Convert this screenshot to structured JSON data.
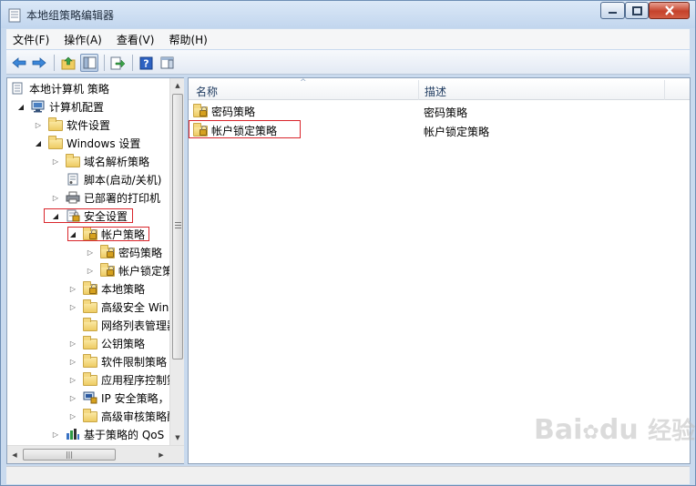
{
  "window": {
    "title": "本地组策略编辑器"
  },
  "menu": [
    "文件(F)",
    "操作(A)",
    "查看(V)",
    "帮助(H)"
  ],
  "toolbar": [
    {
      "icon": "back-arrow-icon"
    },
    {
      "icon": "forward-arrow-icon"
    },
    {
      "icon": "up-folder-icon"
    },
    {
      "icon": "show-hide-tree-icon",
      "active": true
    },
    {
      "icon": "export-list-icon"
    },
    {
      "icon": "help-icon"
    },
    {
      "icon": "properties-pane-icon"
    }
  ],
  "tree": [
    {
      "label": "本地计算机 策略",
      "level": 0,
      "expander": "none",
      "icon": "computer-policy-icon"
    },
    {
      "label": "计算机配置",
      "level": 1,
      "expander": "open",
      "icon": "computer-config-icon"
    },
    {
      "label": "软件设置",
      "level": 2,
      "expander": "closed",
      "icon": "folder-icon"
    },
    {
      "label": "Windows 设置",
      "level": 2,
      "expander": "open",
      "icon": "folder-icon"
    },
    {
      "label": "域名解析策略",
      "level": 3,
      "expander": "closed",
      "icon": "folder-icon"
    },
    {
      "label": "脚本(启动/关机)",
      "level": 3,
      "expander": "none",
      "icon": "script-icon"
    },
    {
      "label": "已部署的打印机",
      "level": 3,
      "expander": "closed",
      "icon": "printer-icon"
    },
    {
      "label": "安全设置",
      "level": 3,
      "expander": "open",
      "icon": "security-settings-icon",
      "highlight": true
    },
    {
      "label": "帐户策略",
      "level": 4,
      "expander": "open",
      "icon": "locked-folder-icon",
      "highlight": true
    },
    {
      "label": "密码策略",
      "level": 5,
      "expander": "closed",
      "icon": "locked-folder-icon"
    },
    {
      "label": "帐户锁定策略",
      "level": 5,
      "expander": "closed",
      "icon": "locked-folder-icon"
    },
    {
      "label": "本地策略",
      "level": 4,
      "expander": "closed",
      "icon": "locked-folder-icon"
    },
    {
      "label": "高级安全 Windows 防火墙",
      "level": 4,
      "expander": "closed",
      "icon": "folder-icon"
    },
    {
      "label": "网络列表管理器策略",
      "level": 4,
      "expander": "none",
      "icon": "folder-icon"
    },
    {
      "label": "公钥策略",
      "level": 4,
      "expander": "closed",
      "icon": "folder-icon"
    },
    {
      "label": "软件限制策略",
      "level": 4,
      "expander": "closed",
      "icon": "folder-icon"
    },
    {
      "label": "应用程序控制策略",
      "level": 4,
      "expander": "closed",
      "icon": "folder-icon"
    },
    {
      "label": "IP 安全策略，在 本地计算机",
      "level": 4,
      "expander": "closed",
      "icon": "ip-security-icon"
    },
    {
      "label": "高级审核策略配置",
      "level": 4,
      "expander": "closed",
      "icon": "folder-icon"
    },
    {
      "label": "基于策略的 QoS",
      "level": 3,
      "expander": "closed",
      "icon": "qos-chart-icon"
    }
  ],
  "list": {
    "columns": [
      "名称",
      "描述"
    ],
    "rows": [
      {
        "name": "密码策略",
        "description": "密码策略",
        "highlight": false
      },
      {
        "name": "帐户锁定策略",
        "description": "帐户锁定策略",
        "highlight": true
      }
    ]
  },
  "watermark": {
    "latin": "Bai",
    "paw": "du",
    "cn": "经验"
  }
}
